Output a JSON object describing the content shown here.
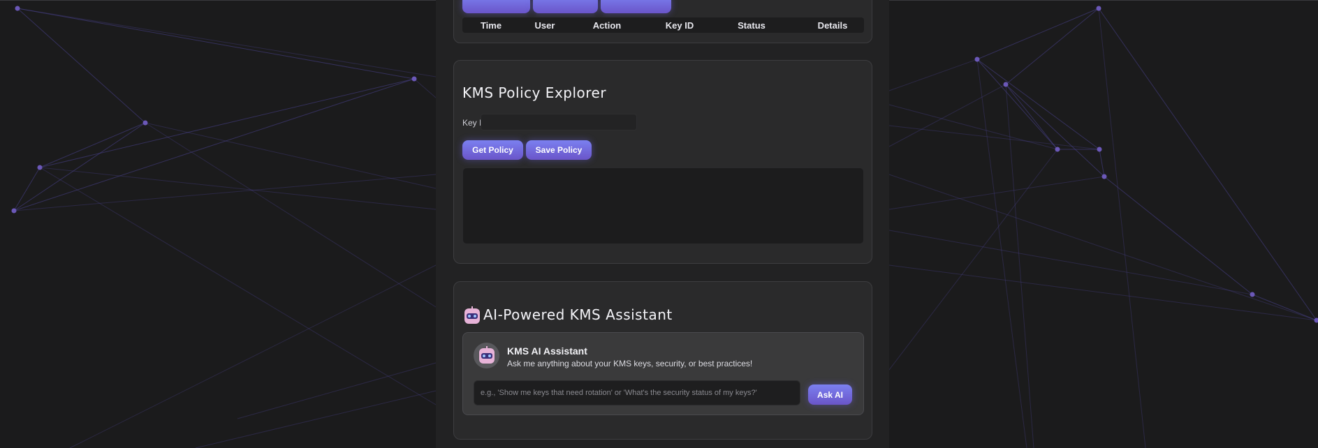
{
  "audit_log": {
    "columns": [
      "Time",
      "User",
      "Action",
      "Key ID",
      "Status",
      "Details"
    ]
  },
  "policy_explorer": {
    "title": "KMS Policy Explorer",
    "key_id_label": "Key ID:",
    "key_id_value": "",
    "get_button": "Get Policy",
    "save_button": "Save Policy",
    "policy_text": ""
  },
  "assistant": {
    "title": "AI-Powered KMS Assistant",
    "icon": "robot-icon",
    "name": "KMS AI Assistant",
    "subtitle": "Ask me anything about your KMS keys, security, or best practices!",
    "input_placeholder": "e.g., 'Show me keys that need rotation' or 'What's the security status of my keys?'",
    "ask_button": "Ask AI"
  },
  "theme": {
    "background": "#1b1b1c",
    "card": "#2a2a2b",
    "accent_start": "#7b80f0",
    "accent_end": "#6a55c9",
    "network_line": "#4a4290",
    "network_node": "#6b58b8"
  }
}
